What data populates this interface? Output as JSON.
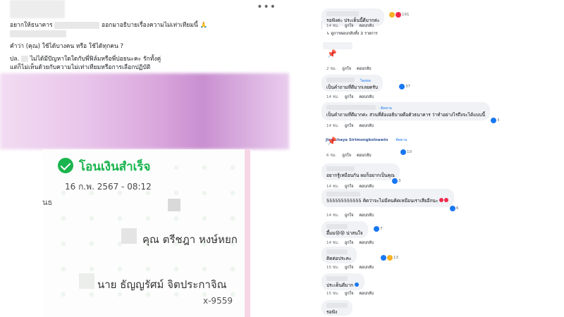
{
  "post": {
    "more_icon": "more-horizontal-icon",
    "lines": [
      "อยากให้ธนาคาร",
      "ออกมาอธิบายเรื่องความไม่เท่าเทียมนี้ 🙏",
      "คำว่า (คุณ) ใช้ได้บางคน หรือ ใช้ได้ทุกคน ?",
      "ปล.",
      "ไม่ได้มีปัญหาใดใดกับพี่ฟิล์มหรือพี่ปอยนะคะ รักทั้งคู่",
      "แต่ก็ไม่เห็นด้วยกับความไม่เท่าเทียมหรือการเลือกปฏิบัติ"
    ]
  },
  "receipt": {
    "status": "โอนเงินสำเร็จ",
    "datetime": "16 ก.พ. 2567 - 08:12",
    "partial": "นธ",
    "sender": "คุณ ตรีชฎา หงษ์หยก",
    "recipient": "นาย ธัญญรัศม์ จิตประกาจิณ",
    "account": "x-9559",
    "colors": {
      "success": "#19b44e",
      "pink_edge": "#f7d6e6"
    }
  },
  "comments": {
    "like_label": "ถูกใจ",
    "reply_label": "ตอบกลับ",
    "items": [
      {
        "text": "รอฟังค่ะ ประเด็นนี้ดีมากค่ะ",
        "time": "14 ชม.",
        "reactions": "191"
      },
      {
        "replies": "↳ ดูการตอบกลับทั้ง 2 รายการ"
      },
      {
        "time": "2 ชม.",
        "pin": "📌"
      },
      {
        "badge": "ไอดอล",
        "text": "เป็นคำถามที่ดีมากเลยครับ",
        "time": "14 ชม.",
        "reactions": "37"
      },
      {
        "badge": "· ติดตาม",
        "text": "เป็นคำถามที่ดีมากค่ะ ส่วนที่ต้องอธิบายคือตัวธนาคาร ว่าทำอย่างไรถึงจะได้แบบนี้",
        "time": "14 ชม.",
        "reactions": "3"
      },
      {
        "author": "Jiratchaya Sirimongkolnawin",
        "badge": "· ติดตาม",
        "pin": "📌",
        "time": "6 ชม.",
        "reactions": "10"
      },
      {
        "text": "อยากรู้เหมือนกัน ผมก็อยากเป็นคุณ",
        "time": "14 ชม.",
        "reactions": "3"
      },
      {
        "text": "555555555555 คิดว่าจะไม่มีคนคิดเหมือนเราเสียอีกนะ",
        "time": "14 ชม.",
        "reactions": "6"
      },
      {
        "text": "อึ้มม😢😢 น่าสนใจ",
        "time": "14 ชม.",
        "reactions": "7"
      },
      {
        "text": "ติดต่อประคะ",
        "time": "15 ชม.",
        "reactions": "13"
      },
      {
        "text": "ประเด็นดีมาก",
        "time": "15 ชม."
      },
      {
        "text": "รอฟัง"
      }
    ]
  }
}
